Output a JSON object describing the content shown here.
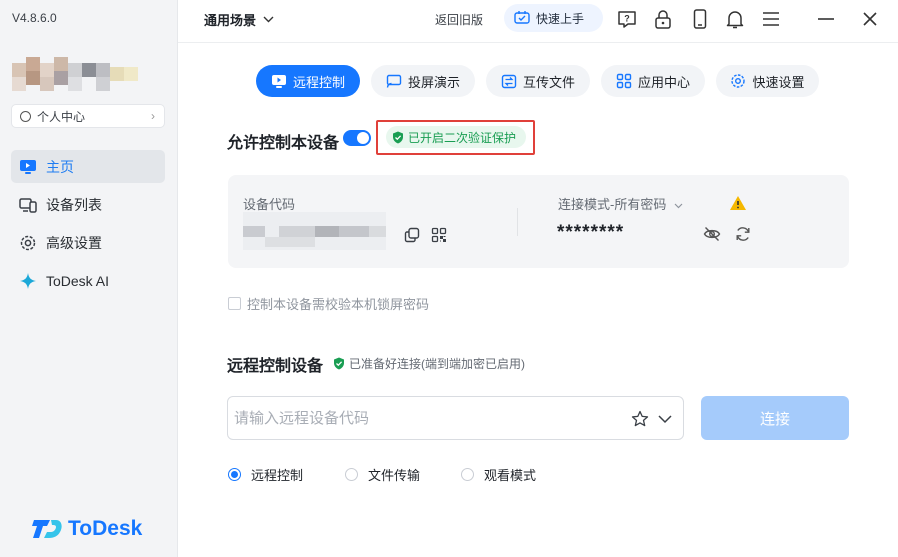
{
  "app": {
    "version": "V4.8.6.0",
    "brand": "ToDesk"
  },
  "sidebar": {
    "personal_center": "个人中心",
    "items": [
      {
        "label": "主页",
        "icon": "monitor-icon",
        "active": true
      },
      {
        "label": "设备列表",
        "icon": "devices-icon",
        "active": false
      },
      {
        "label": "高级设置",
        "icon": "gear-icon",
        "active": false
      },
      {
        "label": "ToDesk AI",
        "icon": "sparkle-icon",
        "active": false
      }
    ]
  },
  "topbar": {
    "scene": "通用场景",
    "old_version": "返回旧版",
    "quick_start": "快速上手",
    "icons": [
      "help-icon",
      "lock-icon",
      "phone-icon",
      "bell-icon",
      "menu-icon",
      "minimize-icon",
      "close-icon"
    ]
  },
  "tabs": [
    {
      "label": "远程控制",
      "active": true
    },
    {
      "label": "投屏演示",
      "active": false
    },
    {
      "label": "互传文件",
      "active": false
    },
    {
      "label": "应用中心",
      "active": false
    },
    {
      "label": "快速设置",
      "active": false
    }
  ],
  "allow_control": {
    "title": "允许控制本设备",
    "enabled": true,
    "verify_badge": "已开启二次验证保护"
  },
  "device": {
    "code_label": "设备代码",
    "mode_label": "连接模式-所有密码",
    "password": "********"
  },
  "lock_screen_check": "控制本设备需校验本机锁屏密码",
  "remote": {
    "title": "远程控制设备",
    "status": "已准备好连接(端到端加密已启用)",
    "input_placeholder": "请输入远程设备代码",
    "connect_label": "连接",
    "modes": [
      {
        "label": "远程控制",
        "selected": true
      },
      {
        "label": "文件传输",
        "selected": false
      },
      {
        "label": "观看模式",
        "selected": false
      }
    ]
  },
  "colors": {
    "accent": "#1677ff",
    "success": "#1a9e53",
    "warning": "#f5b800",
    "highlight": "#e0403a"
  }
}
